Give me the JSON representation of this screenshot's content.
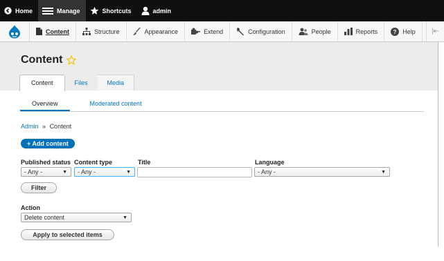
{
  "toolbar": {
    "home": "Home",
    "manage": "Manage",
    "shortcuts": "Shortcuts",
    "user": "admin"
  },
  "tray": {
    "items": [
      "Content",
      "Structure",
      "Appearance",
      "Extend",
      "Configuration",
      "People",
      "Reports",
      "Help"
    ]
  },
  "page": {
    "title": "Content",
    "tabs": [
      "Content",
      "Files",
      "Media"
    ],
    "subtabs": [
      "Overview",
      "Moderated content"
    ],
    "breadcrumb": {
      "admin": "Admin",
      "sep": "»",
      "current": "Content"
    },
    "add_button": "+ Add content"
  },
  "filters": {
    "published_status": {
      "label": "Published status",
      "value": "- Any -"
    },
    "content_type": {
      "label": "Content type",
      "value": "- Any -"
    },
    "title": {
      "label": "Title",
      "value": ""
    },
    "language": {
      "label": "Language",
      "value": "- Any -"
    },
    "filter_button": "Filter"
  },
  "action": {
    "label": "Action",
    "value": "Delete content",
    "apply_button": "Apply to selected items"
  },
  "colors": {
    "link": "#0074bd",
    "primary_button": "#0071b8",
    "toolbar": "#0f0f0f",
    "star": "#f5c400"
  }
}
